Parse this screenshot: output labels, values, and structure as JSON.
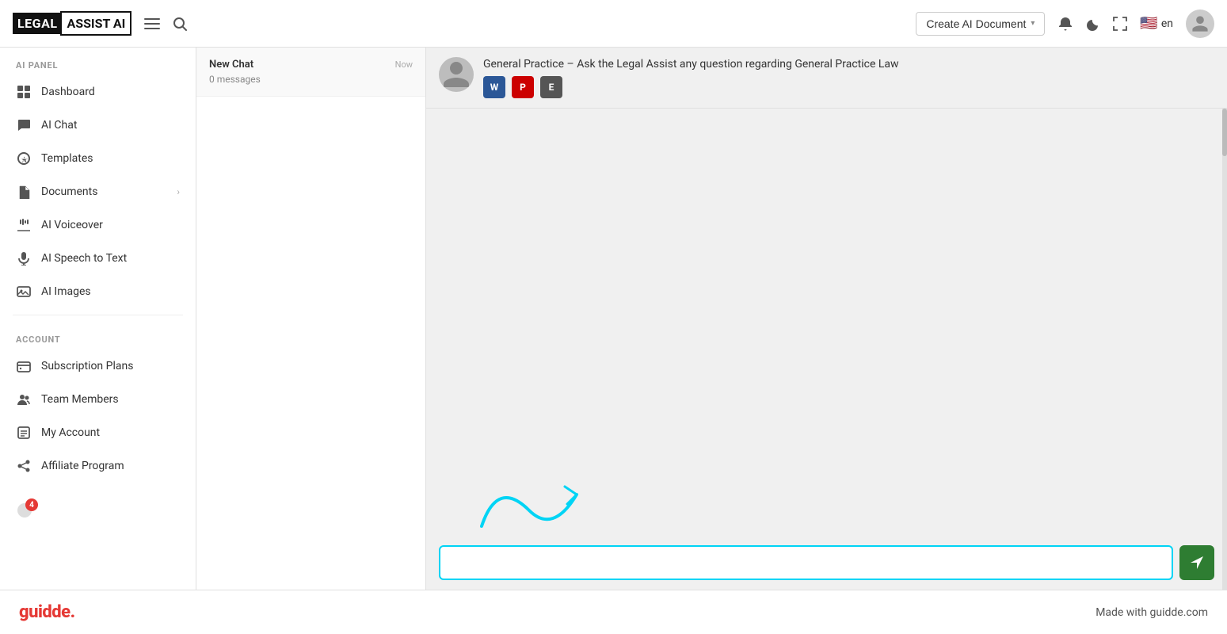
{
  "header": {
    "logo_legal": "LEGAL",
    "logo_assist": "ASSIST AI",
    "create_doc_label": "Create AI Document",
    "lang": "en",
    "menu_icon": "menu",
    "search_icon": "search",
    "bell_icon": "bell",
    "moon_icon": "moon",
    "expand_icon": "expand"
  },
  "sidebar": {
    "ai_panel_label": "AI PANEL",
    "account_label": "ACCOUNT",
    "items_ai": [
      {
        "id": "dashboard",
        "label": "Dashboard",
        "icon": "grid"
      },
      {
        "id": "ai-chat",
        "label": "AI Chat",
        "icon": "chat"
      },
      {
        "id": "templates",
        "label": "Templates",
        "icon": "template"
      },
      {
        "id": "documents",
        "label": "Documents",
        "icon": "doc",
        "has_chevron": true
      },
      {
        "id": "ai-voiceover",
        "label": "AI Voiceover",
        "icon": "voice"
      },
      {
        "id": "ai-speech",
        "label": "AI Speech to Text",
        "icon": "speech"
      },
      {
        "id": "ai-images",
        "label": "AI Images",
        "icon": "image"
      }
    ],
    "items_account": [
      {
        "id": "subscription",
        "label": "Subscription Plans",
        "icon": "subscription"
      },
      {
        "id": "team",
        "label": "Team Members",
        "icon": "team"
      },
      {
        "id": "my-account",
        "label": "My Account",
        "icon": "account"
      },
      {
        "id": "affiliate",
        "label": "Affiliate Program",
        "icon": "affiliate"
      }
    ],
    "notification_count": "4"
  },
  "chat_list": {
    "items": [
      {
        "id": "new-chat",
        "title": "New Chat",
        "messages": "0 messages",
        "time": "Now"
      }
    ]
  },
  "chat_main": {
    "description": "General Practice – Ask the Legal Assist any question regarding General Practice Law",
    "doc_icons": [
      "W",
      "P",
      "E"
    ],
    "input_placeholder": ""
  },
  "guidde_footer": {
    "logo": "guidde.",
    "tagline": "Made with guidde.com"
  }
}
